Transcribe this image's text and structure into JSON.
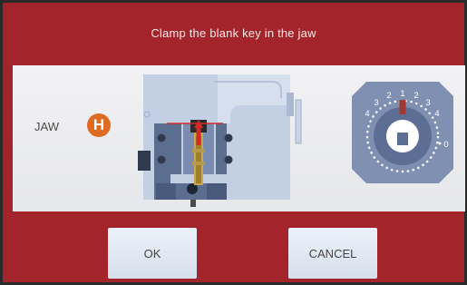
{
  "header": {
    "title": "Clamp the blank key in the jaw"
  },
  "jaw": {
    "label": "JAW",
    "badge": "H"
  },
  "dial": {
    "numbers": [
      "1",
      "2",
      "2",
      "3",
      "3",
      "4",
      "4",
      "0"
    ]
  },
  "buttons": {
    "ok_label": "OK",
    "cancel_label": "CANCEL"
  },
  "colors": {
    "background": "#a4242b",
    "badge": "#dd6b21",
    "indicator": "#d12a2a",
    "machine": "#c3d0e4",
    "dial": "#7f90b3"
  },
  "icons": {
    "jaw_diagram": "jaw-clamp-diagram",
    "dial": "jaw-position-dial"
  }
}
